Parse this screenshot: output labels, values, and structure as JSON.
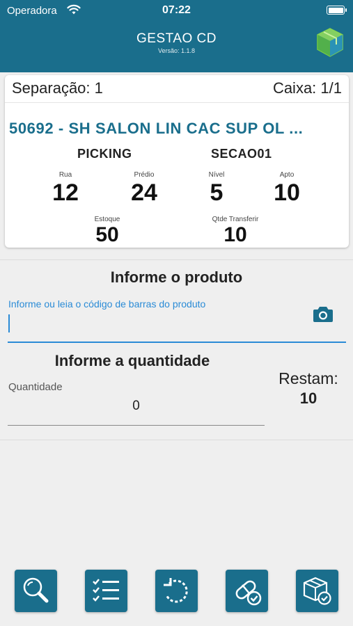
{
  "status_bar": {
    "carrier": "Operadora",
    "time": "07:22"
  },
  "header": {
    "title": "GESTAO CD",
    "version": "Versão: 1.1.8"
  },
  "card": {
    "separacao": "Separação: 1",
    "caixa": "Caixa: 1/1",
    "product": "50692 - SH SALON LIN CAC SUP OL ...",
    "area_left": "PICKING",
    "area_right": "SECAO01",
    "rua_label": "Rua",
    "rua": "12",
    "predio_label": "Prédio",
    "predio": "24",
    "nivel_label": "Nível",
    "nivel": "5",
    "apto_label": "Apto",
    "apto": "10",
    "estoque_label": "Estoque",
    "estoque": "50",
    "qtde_label": "Qtde Transferir",
    "qtde": "10"
  },
  "product_section": {
    "title": "Informe o produto",
    "placeholder": "Informe ou leia o código de barras do produto"
  },
  "quantity_section": {
    "title": "Informe a quantidade",
    "label": "Quantidade",
    "value": "0",
    "restam_label": "Restam:",
    "restam_value": "10"
  },
  "toolbar": {
    "buttons": [
      "search-icon",
      "checklist-icon",
      "undo-icon",
      "pills-check-icon",
      "package-check-icon"
    ]
  },
  "colors": {
    "primary": "#1a6e8c",
    "accent": "#2a8bd6",
    "background": "#efefef"
  }
}
